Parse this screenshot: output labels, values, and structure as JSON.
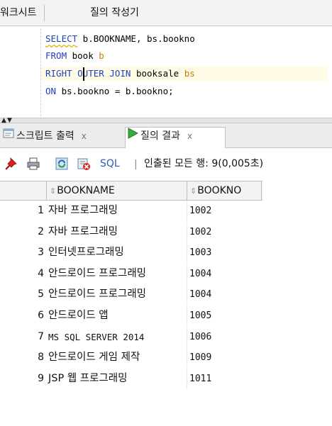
{
  "tabs": {
    "worksheet_label": "워크시트",
    "query_builder_label": "질의 작성기"
  },
  "editor": {
    "line1": {
      "kw": "SELECT",
      "rest": " b.BOOKNAME, bs.bookno"
    },
    "line2": {
      "kw": "FROM",
      "rest": " book ",
      "alias": "b"
    },
    "line3": {
      "kw": "RIGHT OUTER JOIN",
      "rest": " booksale ",
      "alias": "bs"
    },
    "line4": {
      "kw": "ON",
      "rest": " bs.bookno = b.bookno;"
    }
  },
  "result_tabs": {
    "script_output_label": "스크립트 출력",
    "query_result_label": "질의 결과",
    "close_glyph": "x"
  },
  "toolbar": {
    "sql_label": "SQL",
    "separator": "|",
    "status_text": "인출된 모든 행: 9(0,005초)",
    "icons": [
      "pin-icon",
      "print-icon",
      "refresh-icon",
      "cancel-icon"
    ]
  },
  "grid": {
    "columns": [
      "BOOKNAME",
      "BOOKNO"
    ],
    "rows": [
      {
        "n": "1",
        "bookname": "자바 프로그래밍",
        "bookno": "1002"
      },
      {
        "n": "2",
        "bookname": "자바 프로그래밍",
        "bookno": "1002"
      },
      {
        "n": "3",
        "bookname": "인터넷프로그래밍",
        "bookno": "1003"
      },
      {
        "n": "4",
        "bookname": "안드로이드 프로그래밍",
        "bookno": "1004"
      },
      {
        "n": "5",
        "bookname": "안드로이드 프로그래밍",
        "bookno": "1004"
      },
      {
        "n": "6",
        "bookname": "안드로이드 앱",
        "bookno": "1005"
      },
      {
        "n": "7",
        "bookname": "MS SQL SERVER 2014",
        "bookno": "1006"
      },
      {
        "n": "8",
        "bookname": "안드로이드 게임 제작",
        "bookno": "1009"
      },
      {
        "n": "9",
        "bookname": "JSP 웹 프로그래밍",
        "bookno": "1011"
      }
    ]
  },
  "colors": {
    "keyword": "#1f3fbf",
    "alias": "#c87c00",
    "sql_link": "#2a5db0",
    "active_line": "#fffbe6"
  }
}
